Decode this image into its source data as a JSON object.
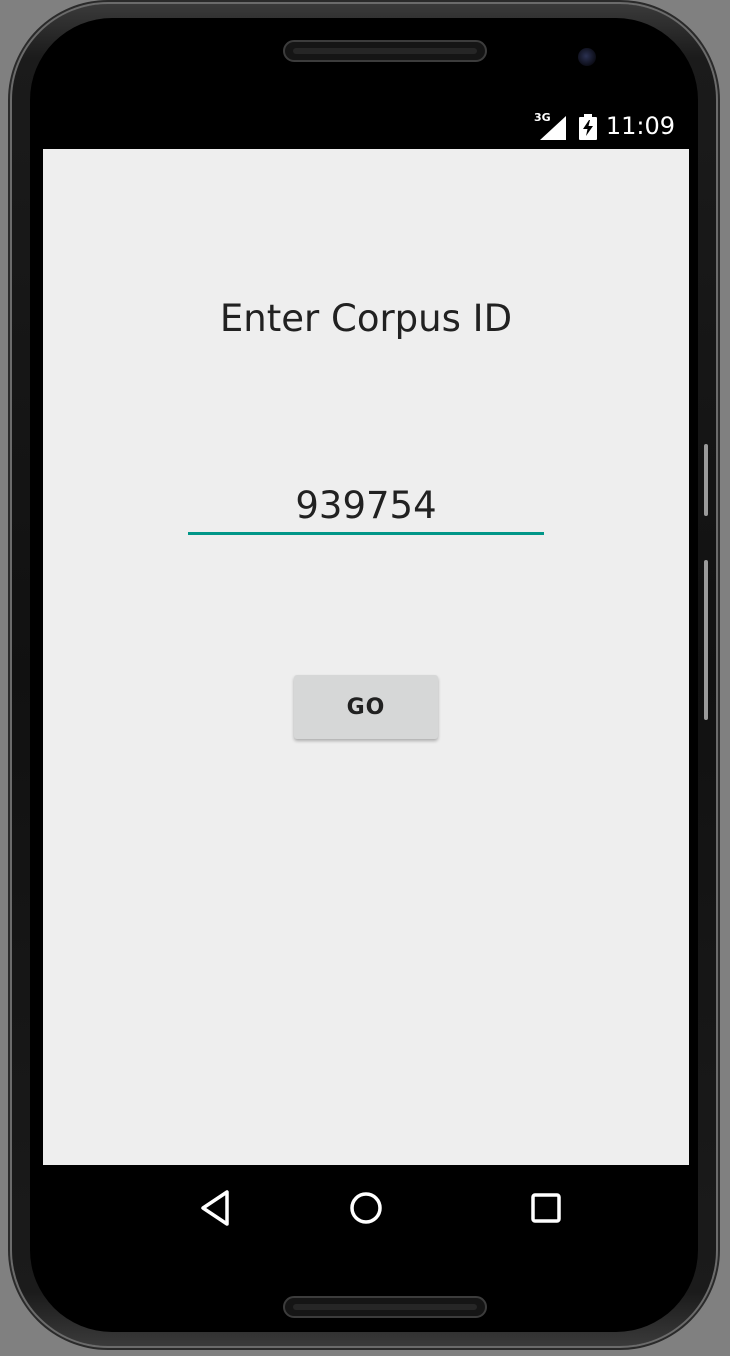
{
  "status_bar": {
    "network_type": "3G",
    "time": "11:09",
    "icons": [
      "signal-icon",
      "battery-charging-icon"
    ]
  },
  "main": {
    "title": "Enter Corpus ID",
    "corpus_input": {
      "value": "939754",
      "placeholder": ""
    },
    "go_button_label": "GO"
  },
  "nav_bar": {
    "icons": [
      "back-icon",
      "home-icon",
      "recents-icon"
    ]
  },
  "colors": {
    "accent": "#009688",
    "background": "#eeeeee",
    "button": "#d6d7d7",
    "text": "#212121"
  }
}
